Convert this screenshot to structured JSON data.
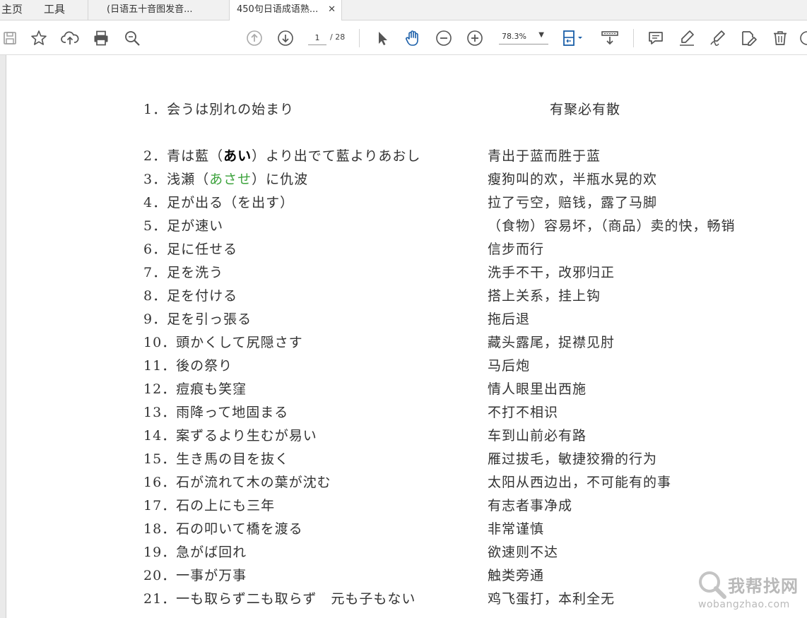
{
  "tabs": {
    "home": "主页",
    "tools": "工具",
    "documents": [
      {
        "label": "(日语五十音图发音...",
        "active": false
      },
      {
        "label": "450句日语成语熟...",
        "active": true,
        "close": "✕"
      }
    ]
  },
  "toolbar": {
    "icons": [
      "save-icon",
      "bookmark-star-icon",
      "upload-cloud-icon",
      "print-icon",
      "find-zoom-icon",
      "previous-page-icon",
      "next-page-icon",
      "select-arrow-icon",
      "hand-tool-icon",
      "zoom-out-icon",
      "zoom-in-icon",
      "fit-page-icon",
      "scroll-mode-icon",
      "comment-icon",
      "highlight-icon",
      "sign-icon",
      "edit-pdf-icon",
      "delete-icon"
    ],
    "page_current": "1",
    "page_total": "/ 28",
    "zoom": "78.3%",
    "accent_color": "#1a5ea8"
  },
  "document": {
    "entries": [
      {
        "jp": "1．会うは別れの始まり",
        "cn": "有聚必有散"
      },
      {
        "jp_pre": "2．青は藍（",
        "jp_mark": "あい",
        "jp_post": "）より出でて藍よりあおし",
        "cn": "青出于蓝而胜于蓝"
      },
      {
        "jp_pre": "3．浅瀬（",
        "jp_mark": "あさせ",
        "jp_post": "）に仇波",
        "cn": "瘦狗叫的欢，半瓶水晃的欢",
        "mark_color": "#3da33d"
      },
      {
        "jp": "4．足が出る（を出す）",
        "cn": "拉了亏空，赔钱，露了马脚"
      },
      {
        "jp": "5．足が速い",
        "cn": "（食物）容易坏，（商品）卖的快，畅销"
      },
      {
        "jp": "6．足に任せる",
        "cn": "信步而行"
      },
      {
        "jp": "7．足を洗う",
        "cn": "洗手不干，改邪归正"
      },
      {
        "jp": "8．足を付ける",
        "cn": "搭上关系，挂上钩"
      },
      {
        "jp": "9．足を引っ張る",
        "cn": "拖后退"
      },
      {
        "jp": "10．頭かくして尻隠さす",
        "cn": "藏头露尾，捉襟见肘"
      },
      {
        "jp": "11．後の祭り",
        "cn": "马后炮"
      },
      {
        "jp": "12．痘痕も笑窪",
        "cn": "情人眼里出西施"
      },
      {
        "jp": "13．雨降って地固まる",
        "cn": "不打不相识"
      },
      {
        "jp": "14．案ずるより生むが易い",
        "cn": "车到山前必有路"
      },
      {
        "jp": "15．生き馬の目を抜く",
        "cn": "雁过拔毛，敏捷狡猾的行为"
      },
      {
        "jp": "16．石が流れて木の葉が沈む",
        "cn": "太阳从西边出，不可能有的事"
      },
      {
        "jp": "17．石の上にも三年",
        "cn": "有志者事净成"
      },
      {
        "jp": "18．石の叩いて橋を渡る",
        "cn": "非常谨慎"
      },
      {
        "jp": "19．急がば回れ",
        "cn": "欲速则不达"
      },
      {
        "jp": "20．一事が万事",
        "cn": "触类旁通"
      },
      {
        "jp": "21．一も取らず二も取らず　元も子もない",
        "cn": "鸡飞蛋打，本利全无"
      }
    ]
  },
  "watermark": {
    "text": "我帮找网",
    "url": "wobangzhao.com"
  }
}
